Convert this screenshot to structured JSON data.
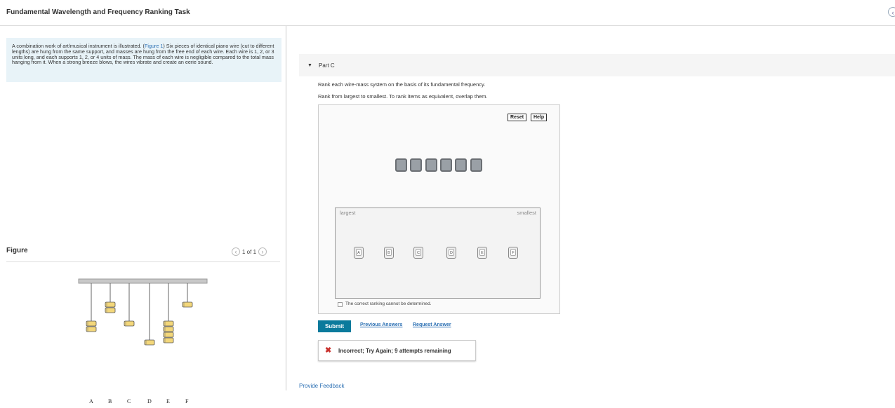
{
  "header": {
    "title": "Fundamental Wavelength and Frequency Ranking Task",
    "back_icon": "chevron-left-icon"
  },
  "intro": {
    "text_before": "A combination work of art/musical instrument is illustrated. (",
    "figure_link": "Figure 1",
    "text_after": ") Six pieces of identical piano wire (cut to different lengths) are hung from the same support, and masses are hung from the free end of each wire. Each wire is 1, 2, or 3 units long, and each supports 1, 2, or 4 units of mass. The mass of each wire is negligible compared to the total mass hanging from it. When a strong breeze blows, the wires vibrate and create an eerie sound."
  },
  "figure": {
    "label": "Figure",
    "pager": "1 of 1",
    "labels": [
      "A",
      "B",
      "C",
      "D",
      "E",
      "F"
    ],
    "wire_lengths": [
      2,
      1,
      2,
      3,
      2,
      1
    ],
    "masses": [
      2,
      2,
      1,
      1,
      4,
      1
    ]
  },
  "part": {
    "label": "Part C",
    "prompt": "Rank each wire-mass system on the basis of its fundamental frequency.",
    "instruction": "Rank from largest to smallest. To rank items as equivalent, overlap them.",
    "reset_label": "Reset",
    "help_label": "Help",
    "largest_label": "largest",
    "smallest_label": "smallest",
    "items": [
      "A",
      "B",
      "C",
      "D",
      "E",
      "F"
    ],
    "checkbox_label": "The correct ranking cannot be determined."
  },
  "actions": {
    "submit_label": "Submit",
    "previous_answers": "Previous Answers",
    "request_answer": "Request Answer"
  },
  "feedback": {
    "message": "Incorrect; Try Again; 9 attempts remaining",
    "status_color": "#c9302c"
  },
  "footer": {
    "provide_feedback": "Provide Feedback"
  },
  "colors": {
    "accent": "#0b7a9c",
    "link": "#2a6fb3",
    "intro_bg": "#e8f3f8",
    "weight_fill": "#f3d77a"
  }
}
